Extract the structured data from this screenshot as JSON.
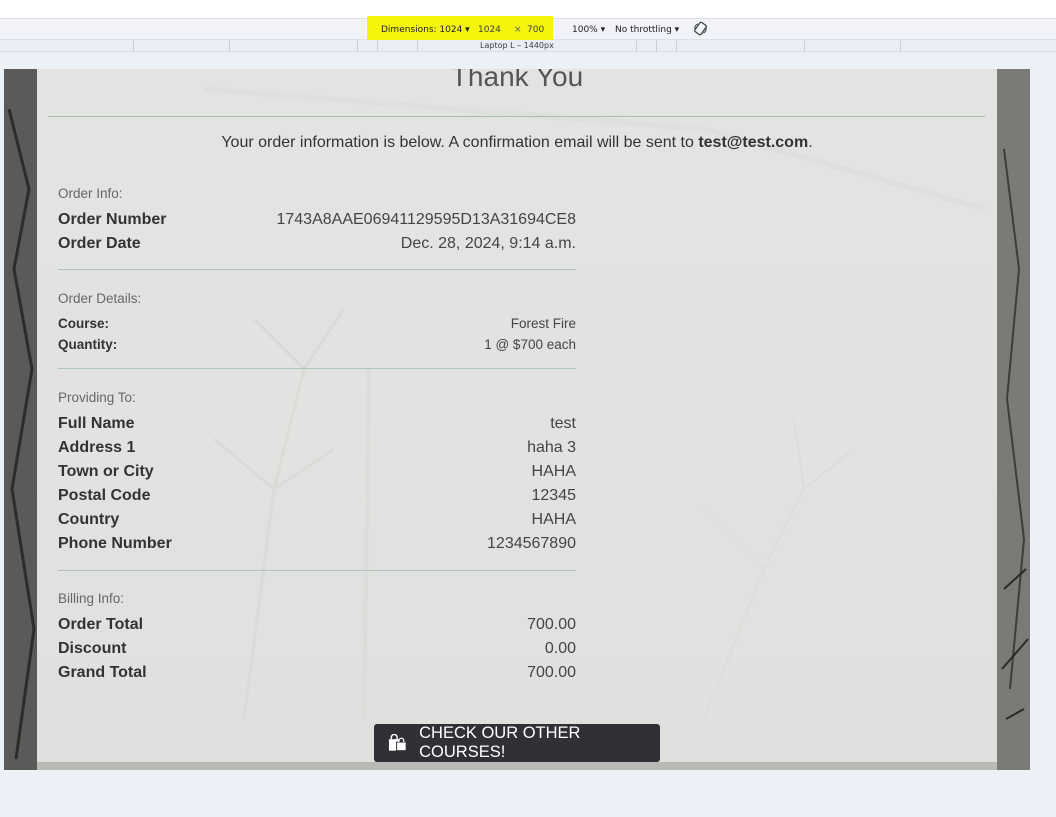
{
  "devtools": {
    "dimensions_label": "Dimensions: 1024 ▾",
    "width": "1024",
    "times": "×",
    "height": "700",
    "zoom": "100% ▾",
    "throttling": "No throttling ▾",
    "preset_label": "Laptop L – 1440px"
  },
  "page": {
    "title": "Thank You",
    "intro_text": "Your order information is below. A confirmation email will be sent to ",
    "intro_email": "test@test.com",
    "intro_end": "."
  },
  "order_info": {
    "label": "Order Info:",
    "rows": [
      {
        "key": "Order Number",
        "value": "1743A8AAE06941129595D13A31694CE8"
      },
      {
        "key": "Order Date",
        "value": "Dec. 28, 2024, 9:14 a.m."
      }
    ]
  },
  "order_details": {
    "label": "Order Details:",
    "rows": [
      {
        "key": "Course:",
        "value": "Forest Fire"
      },
      {
        "key": "Quantity:",
        "value": "1 @ $700 each"
      }
    ]
  },
  "providing_to": {
    "label": "Providing To:",
    "rows": [
      {
        "key": "Full Name",
        "value": "test"
      },
      {
        "key": "Address 1",
        "value": "haha 3"
      },
      {
        "key": "Town or City",
        "value": "HAHA"
      },
      {
        "key": "Postal Code",
        "value": "12345"
      },
      {
        "key": "Country",
        "value": "HAHA"
      },
      {
        "key": "Phone Number",
        "value": "1234567890"
      }
    ]
  },
  "billing_info": {
    "label": "Billing Info:",
    "rows": [
      {
        "key": "Order Total",
        "value": "700.00"
      },
      {
        "key": "Discount",
        "value": "0.00"
      },
      {
        "key": "Grand Total",
        "value": "700.00"
      }
    ]
  },
  "cta": {
    "label": "CHECK OUR OTHER COURSES!",
    "icon": "shopping-bags-icon"
  },
  "colors": {
    "divider": "#afc4ba",
    "button_bg": "#2f3136",
    "highlight": "#f4f40c"
  }
}
